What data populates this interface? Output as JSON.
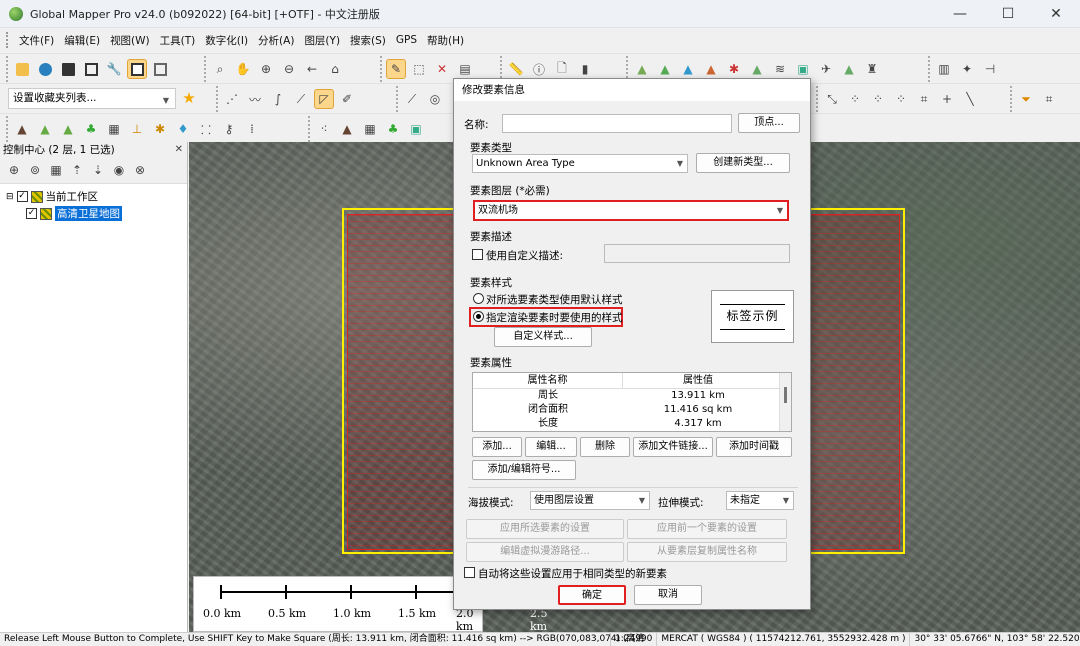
{
  "window": {
    "title": "Global Mapper Pro v24.0 (b092022) [64-bit] [+OTF] - 中文注册版",
    "minimize": "—",
    "maximize": "☐",
    "close": "✕"
  },
  "menu": [
    "文件(F)",
    "编辑(E)",
    "视图(W)",
    "工具(T)",
    "数字化(I)",
    "分析(A)",
    "图层(Y)",
    "搜索(S)",
    "GPS",
    "帮助(H)"
  ],
  "toolbar": {
    "favorites_combo": "设置收藏夹列表..."
  },
  "control_center": {
    "title": "控制中心 (2 层, 1 已选)",
    "close": "✕",
    "tree": [
      {
        "label": "当前工作区",
        "checked": true
      },
      {
        "label": "高清卫星地图",
        "checked": true,
        "selected": true
      }
    ]
  },
  "scalebar": {
    "labels": [
      "0.0 km",
      "0.5 km",
      "1.0 km",
      "1.5 km",
      "2.0 km",
      "2.5 km"
    ]
  },
  "status": {
    "message": "Release Left Mouse Button to Complete, Use SHIFT Key to Make Square (周长: 13.911 km, 闭合面积: 11.416 sq km) --> RGB(070,083,074) (高清",
    "scale": "1:24990",
    "projection": "MERCAT ( WGS84 ) ( 11574212.761, 3552932.428 m )",
    "coords": "30° 33' 05.6766\" N, 103° 58' 22.5201\" E"
  },
  "dialog": {
    "title": "修改要素信息",
    "name_label": "名称:",
    "name_value": "",
    "vertices_btn": "顶点...",
    "type_section": "要素类型",
    "type_value": "Unknown Area Type",
    "create_type_btn": "创建新类型...",
    "layer_section": "要素图层 (*必需)",
    "layer_value": "双流机场",
    "desc_section": "要素描述",
    "use_custom_desc": "使用自定义描述:",
    "style_section": "要素样式",
    "style_default": "对所选要素类型使用默认样式",
    "style_specify": "指定渲染要素时要使用的样式",
    "custom_style_btn": "自定义样式...",
    "sample_label": "标签示例",
    "attr_section": "要素属性",
    "attr_headers": [
      "属性名称",
      "属性值"
    ],
    "attr_rows": [
      {
        "name": "周长",
        "value": "13.911 km"
      },
      {
        "name": "闭合面积",
        "value": "11.416 sq km"
      },
      {
        "name": "长度",
        "value": "4.317 km"
      }
    ],
    "add_btn": "添加...",
    "edit_btn": "编辑...",
    "delete_btn": "删除",
    "add_link_btn": "添加文件链接...",
    "add_time_btn": "添加时间戳",
    "add_symbol_btn": "添加/编辑符号...",
    "elev_label": "海拔模式:",
    "elev_value": "使用图层设置",
    "extrude_label": "拉伸模式:",
    "extrude_value": "未指定",
    "apply_sel_btn": "应用所选要素的设置",
    "apply_prev_btn": "应用前一个要素的设置",
    "edit_path_btn": "编辑虚拟漫游路径...",
    "copy_attr_btn": "从要素层复制属性名称",
    "auto_apply": "自动将这些设置应用于相同类型的新要素",
    "ok_btn": "确定",
    "cancel_btn": "取消"
  }
}
